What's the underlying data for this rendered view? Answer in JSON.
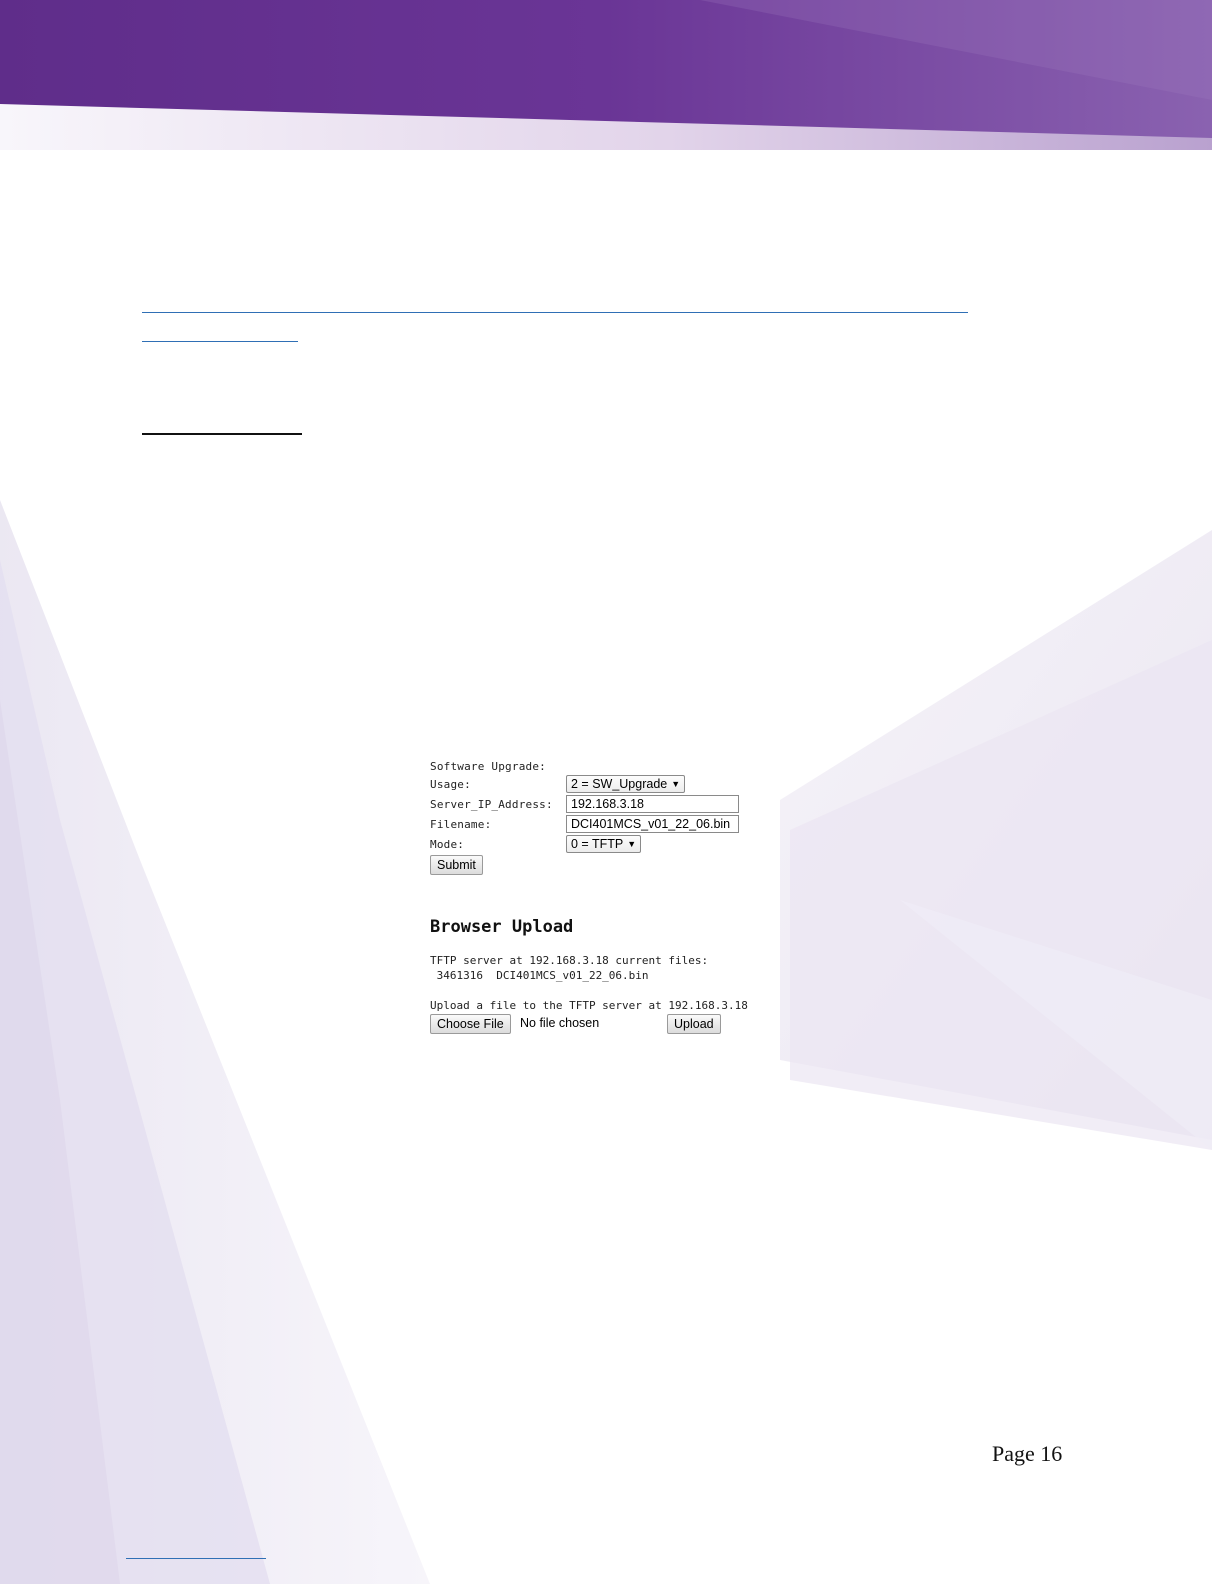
{
  "form": {
    "title": "Software Upgrade:",
    "usage": {
      "label": "Usage:",
      "selected": "2 = SW_Upgrade"
    },
    "server_ip": {
      "label": "Server_IP_Address:",
      "value": "192.168.3.18"
    },
    "filename": {
      "label": "Filename:",
      "value": "DCI401MCS_v01_22_06.bin"
    },
    "mode": {
      "label": "Mode:",
      "selected": "0 = TFTP"
    },
    "submit_label": "Submit"
  },
  "browser_upload": {
    "heading": "Browser Upload",
    "server_files_line": "TFTP server at 192.168.3.18 current files:",
    "file_entry": " 3461316  DCI401MCS_v01_22_06.bin",
    "upload_prompt": "Upload a file to the TFTP server at 192.168.3.18",
    "choose_file_label": "Choose File",
    "no_file_text": "No file chosen",
    "upload_label": "Upload"
  },
  "page_number": "Page 16",
  "colors": {
    "header_purple": "#663090",
    "link_blue": "#2f6fb5"
  }
}
